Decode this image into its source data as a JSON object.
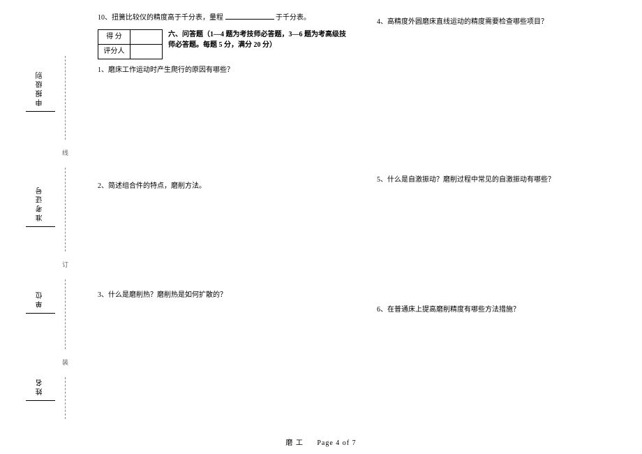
{
  "binding": {
    "labels": [
      "申报级别",
      "准考证号",
      "单位",
      "姓名"
    ],
    "knots": [
      "线",
      "订",
      "装"
    ]
  },
  "fill_q10": {
    "prefix": "10、扭簧比较仪的精度高于千分表，量程",
    "suffix": "于千分表。"
  },
  "score_table": {
    "row1_label": "得   分",
    "row2_label": "评分人"
  },
  "section6_title": "六、问答题（1—4 题为考技师必答题，3—6 题为考高级技师必答题。每题 5 分，满分 20 分）",
  "questions": {
    "q1": "1、磨床工作运动时产生爬行的原因有哪些？",
    "q2": "2、简述组合件的特点，磨削方法。",
    "q3": "3、什么是磨削热？磨削热是如何扩散的？",
    "q4": "4、高精度外圆磨床直线运动的精度需要检查哪些项目？",
    "q5": "5、什么是自激振动？磨削过程中常见的自激振动有哪些？",
    "q6": "6、在普通床上提高磨削精度有哪些方法措施？"
  },
  "footer": {
    "subject": "磨  工",
    "page": "Page 4 of 7"
  }
}
